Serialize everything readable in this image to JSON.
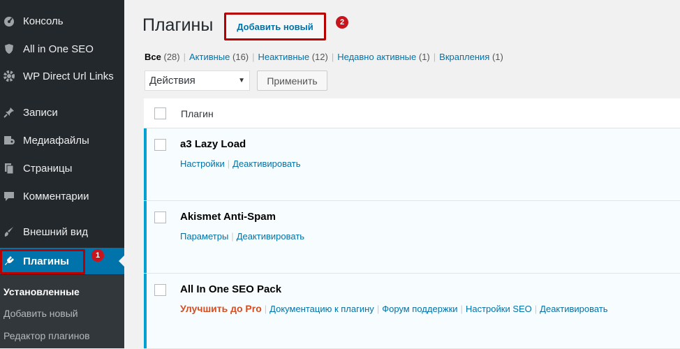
{
  "sidebar": {
    "items": [
      {
        "label": "Консоль",
        "icon": "dashboard-icon"
      },
      {
        "label": "All in One SEO",
        "icon": "shield-icon"
      },
      {
        "label": "WP Direct Url Links",
        "icon": "gear-icon"
      },
      {
        "label": "Записи",
        "icon": "pin-icon"
      },
      {
        "label": "Медиафайлы",
        "icon": "media-icon"
      },
      {
        "label": "Страницы",
        "icon": "pages-icon"
      },
      {
        "label": "Комментарии",
        "icon": "comment-icon"
      },
      {
        "label": "Внешний вид",
        "icon": "brush-icon"
      },
      {
        "label": "Плагины",
        "icon": "plugin-icon"
      }
    ],
    "submenu": [
      {
        "label": "Установленные"
      },
      {
        "label": "Добавить новый"
      },
      {
        "label": "Редактор плагинов"
      }
    ],
    "badge": "1"
  },
  "header": {
    "title": "Плагины",
    "add_new": "Добавить новый",
    "badge": "2"
  },
  "filters": {
    "all": {
      "label": "Все",
      "count": "(28)"
    },
    "active": {
      "label": "Активные",
      "count": "(16)"
    },
    "inactive": {
      "label": "Неактивные",
      "count": "(12)"
    },
    "recent": {
      "label": "Недавно активные",
      "count": "(1)"
    },
    "dropins": {
      "label": "Вкрапления",
      "count": "(1)"
    }
  },
  "bulk": {
    "selected": "Действия",
    "apply": "Применить"
  },
  "table": {
    "header": "Плагин",
    "rows": [
      {
        "name": "a3 Lazy Load",
        "actions": [
          "Настройки",
          "Деактивировать"
        ]
      },
      {
        "name": "Akismet Anti-Spam",
        "actions": [
          "Параметры",
          "Деактивировать"
        ]
      },
      {
        "name": "All In One SEO Pack",
        "upgrade": "Улучшить до Pro",
        "actions": [
          "Документацию к плагину",
          "Форум поддержки",
          "Настройки SEO",
          "Деактивировать"
        ]
      }
    ]
  },
  "colors": {
    "sidebar": "#23282d",
    "accent": "#0073aa",
    "marker": "#b80000",
    "active_stripe": "#00a0d2"
  }
}
